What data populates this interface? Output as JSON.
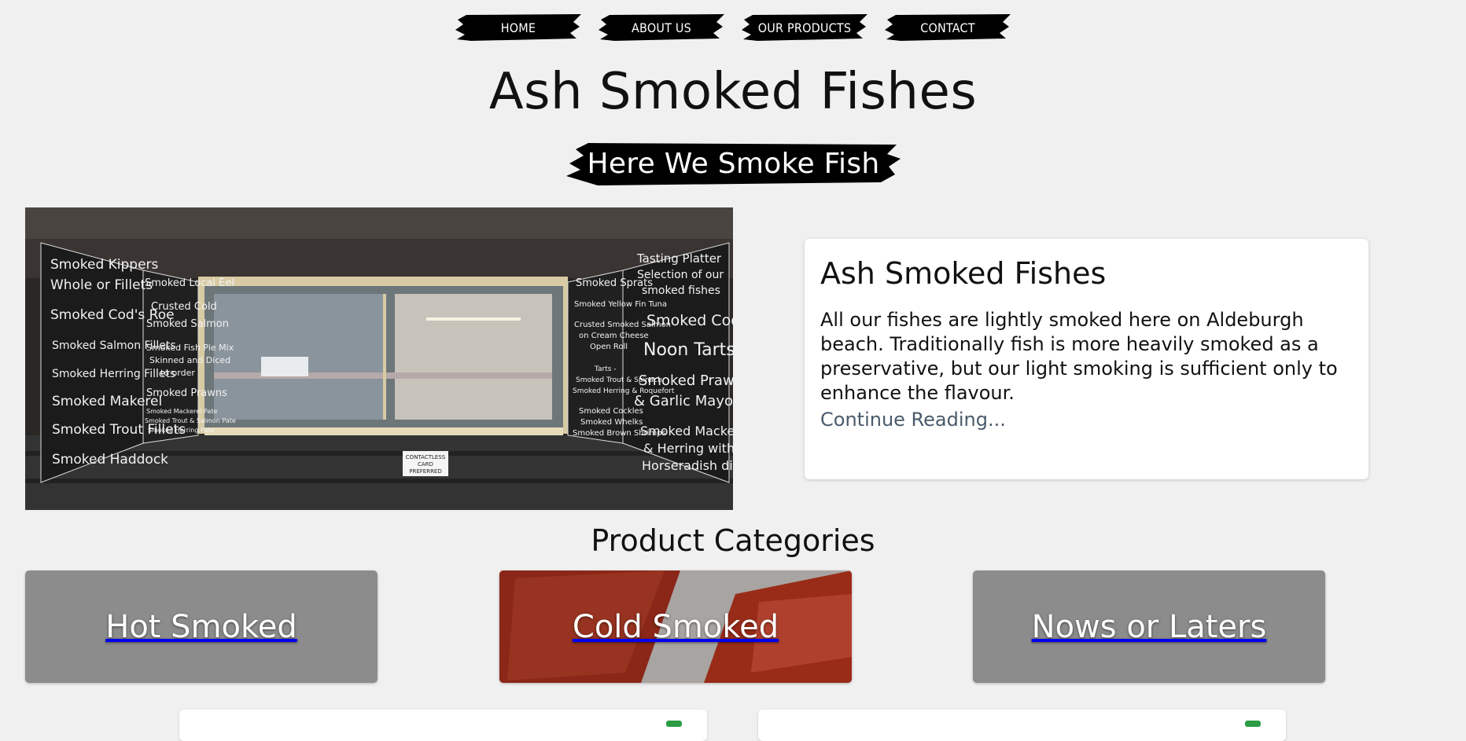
{
  "nav": {
    "items": [
      {
        "label": "HOME"
      },
      {
        "label": "ABOUT US"
      },
      {
        "label": "OUR PRODUCTS"
      },
      {
        "label": "CONTACT"
      }
    ]
  },
  "site": {
    "title": "Ash Smoked Fishes",
    "tagline": "Here We Smoke Fish"
  },
  "hero": {
    "image_alt": "Smoked fish stall window with menu boards",
    "left_board": [
      "Smoked Kippers",
      "Whole or Fillets",
      "Smoked Cod's Roe",
      "Smoked Salmon Fillets",
      "Smoked Herring Fillets",
      "Smoked Makerel",
      "Smoked Trout Fillets",
      "Smoked Haddock"
    ],
    "left_board_2": [
      "Smoked Local Eel",
      "Crusted Cold",
      "Smoked Salmon",
      "Smoked Fish Pie Mix",
      "Skinned and Diced",
      "to order",
      "Smoked Prawns",
      "Smoked Mackerel Pate",
      "Smoked Trout & Salmon Pate",
      "Smoked Herring Pate"
    ],
    "right_board": [
      "Smoked Sprats",
      "Smoked Yellow Fin Tuna",
      "Crusted Smoked Salmon",
      "on Cream Cheese",
      "Open Roll",
      "Tarts -",
      "Smoked Trout & Spinach",
      "Smoked Herring & Roquefort",
      "Smoked Cockles",
      "Smoked Whelks",
      "Smoked Brown Shrimps"
    ],
    "right_board_2": [
      "Tasting Platter",
      "Selection of our",
      "smoked fishes",
      "Smoked Cod",
      "Noon Tarts",
      "Smoked Prawns",
      "& Garlic Mayo Dip",
      "Smoked Mackerel",
      "& Herring with",
      "Horseradish dip"
    ],
    "sign": [
      "CONTACTLESS",
      "CARD",
      "PREFERRED"
    ]
  },
  "intro_card": {
    "title": "Ash Smoked Fishes",
    "body": "All our fishes are lightly smoked here on Aldeburgh beach. Traditionally fish is more heavily smoked as a preservative, but our light smoking is sufficient only to enhance the flavour.",
    "link": "Continue Reading..."
  },
  "categories": {
    "heading": "Product Categories",
    "items": [
      {
        "label": "Hot Smoked"
      },
      {
        "label": "Cold Smoked"
      },
      {
        "label": "Nows or Laters"
      }
    ]
  },
  "colors": {
    "background": "#f0f0f0",
    "tile_gray": "#8c8c8c",
    "badge_green": "#2a9d45",
    "link": "#4a5a6a"
  }
}
